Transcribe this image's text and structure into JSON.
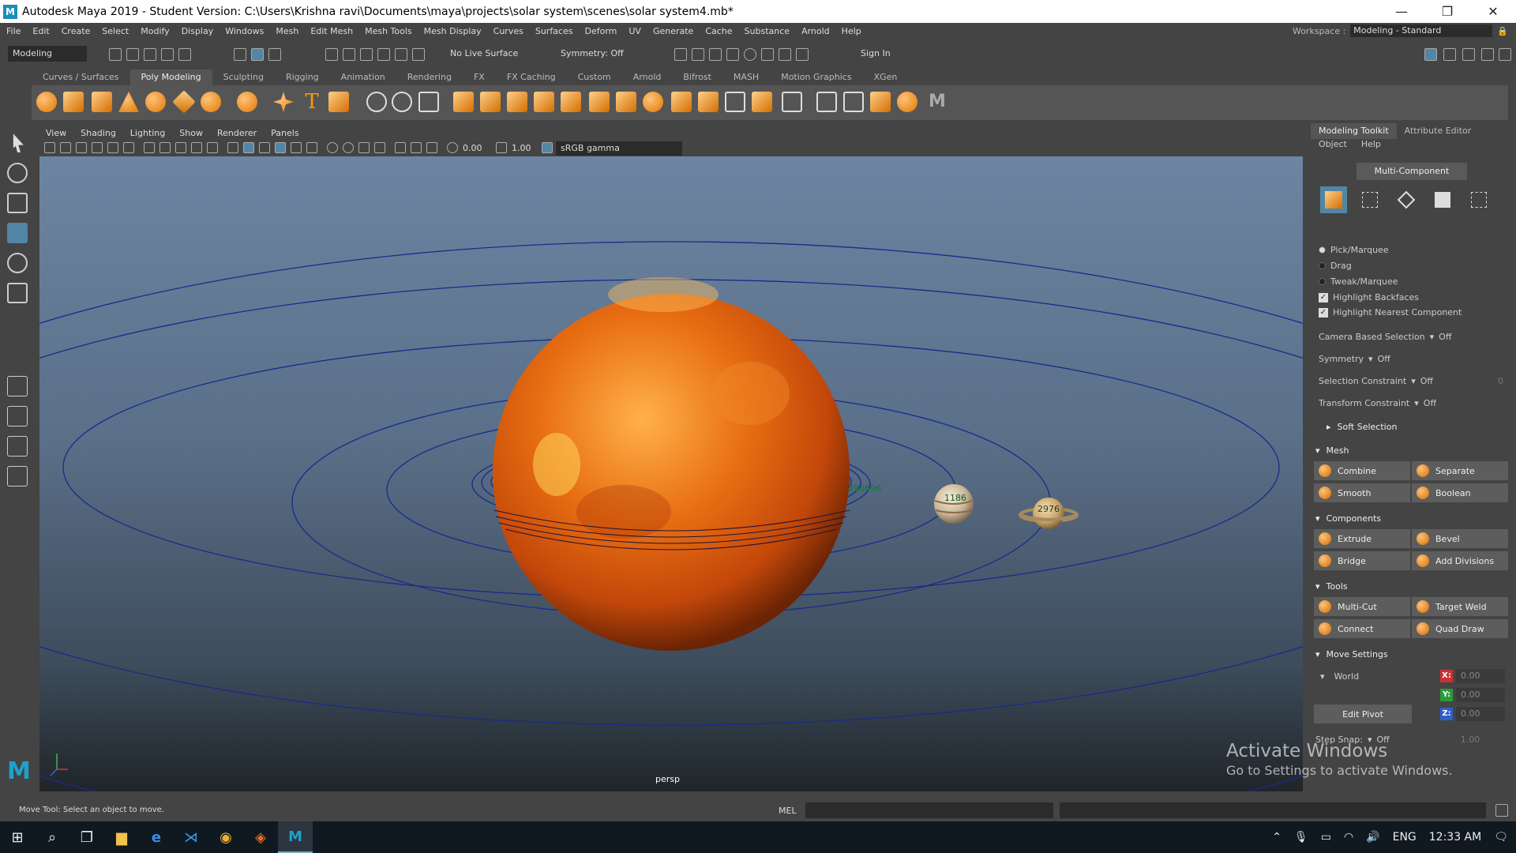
{
  "window": {
    "title": "Autodesk Maya 2019 - Student Version: C:\\Users\\Krishna ravi\\Documents\\maya\\projects\\solar system\\scenes\\solar system4.mb*",
    "minimize": "—",
    "maximize": "❐",
    "close": "✕"
  },
  "menubar": {
    "items": [
      "File",
      "Edit",
      "Create",
      "Select",
      "Modify",
      "Display",
      "Windows",
      "Mesh",
      "Edit Mesh",
      "Mesh Tools",
      "Mesh Display",
      "Curves",
      "Surfaces",
      "Deform",
      "UV",
      "Generate",
      "Cache",
      "Substance",
      "Arnold",
      "Help"
    ],
    "workspace_label": "Workspace :",
    "workspace_value": "Modeling - Standard"
  },
  "statusline": {
    "mode": "Modeling",
    "live_surface": "No Live Surface",
    "symmetry": "Symmetry: Off",
    "sign_in": "Sign In"
  },
  "shelf": {
    "tabs": [
      "Curves / Surfaces",
      "Poly Modeling",
      "Sculpting",
      "Rigging",
      "Animation",
      "Rendering",
      "FX",
      "FX Caching",
      "Custom",
      "Arnold",
      "Bifrost",
      "MASH",
      "Motion Graphics",
      "XGen"
    ],
    "active_tab": "Poly Modeling"
  },
  "panel": {
    "menus": [
      "View",
      "Shading",
      "Lighting",
      "Show",
      "Renderer",
      "Panels"
    ],
    "exposure": "0.00",
    "gamma": "1.00",
    "colorspace": "sRGB gamma",
    "camera": "persp",
    "label_planet1": "1186",
    "label_planet2": "2976",
    "label_sun_ring": "296696"
  },
  "toolkit": {
    "tabs": [
      "Modeling Toolkit",
      "Attribute Editor"
    ],
    "sub_menus": [
      "Object",
      "Help"
    ],
    "multi_component": "Multi-Component",
    "pick_marquee": "Pick/Marquee",
    "drag": "Drag",
    "tweak_marquee": "Tweak/Marquee",
    "highlight_backfaces": "Highlight Backfaces",
    "highlight_nearest": "Highlight Nearest Component",
    "camera_based_selection": "Camera Based Selection",
    "camera_based_selection_value": "Off",
    "symmetry": "Symmetry",
    "symmetry_value": "Off",
    "selection_constraint": "Selection Constraint",
    "selection_constraint_value": "Off",
    "selection_constraint_num": "0",
    "transform_constraint": "Transform Constraint",
    "transform_constraint_value": "Off",
    "soft_selection": "Soft Selection",
    "mesh_section": "Mesh",
    "combine": "Combine",
    "separate": "Separate",
    "smooth": "Smooth",
    "boolean": "Boolean",
    "components_section": "Components",
    "extrude": "Extrude",
    "bevel": "Bevel",
    "bridge": "Bridge",
    "add_divisions": "Add Divisions",
    "tools_section": "Tools",
    "multi_cut": "Multi-Cut",
    "target_weld": "Target Weld",
    "connect": "Connect",
    "quad_draw": "Quad Draw",
    "move_settings": "Move Settings",
    "world": "World",
    "x": "X:",
    "y": "Y:",
    "z": "Z:",
    "x_val": "0.00",
    "y_val": "0.00",
    "z_val": "0.00",
    "edit_pivot": "Edit Pivot",
    "step_snap": "Step Snap:",
    "step_snap_value": "Off",
    "step_snap_num": "1.00"
  },
  "commandline": {
    "help_text": "Move Tool: Select an object to move.",
    "mel": "MEL"
  },
  "watermark": {
    "line1": "Activate Windows",
    "line2": "Go to Settings to activate Windows."
  },
  "taskbar": {
    "language": "ENG",
    "time": "12:33 AM"
  },
  "colors": {
    "accent": "#5285a6",
    "sun": "#e06d10",
    "orbit": "#1a2a8a"
  }
}
